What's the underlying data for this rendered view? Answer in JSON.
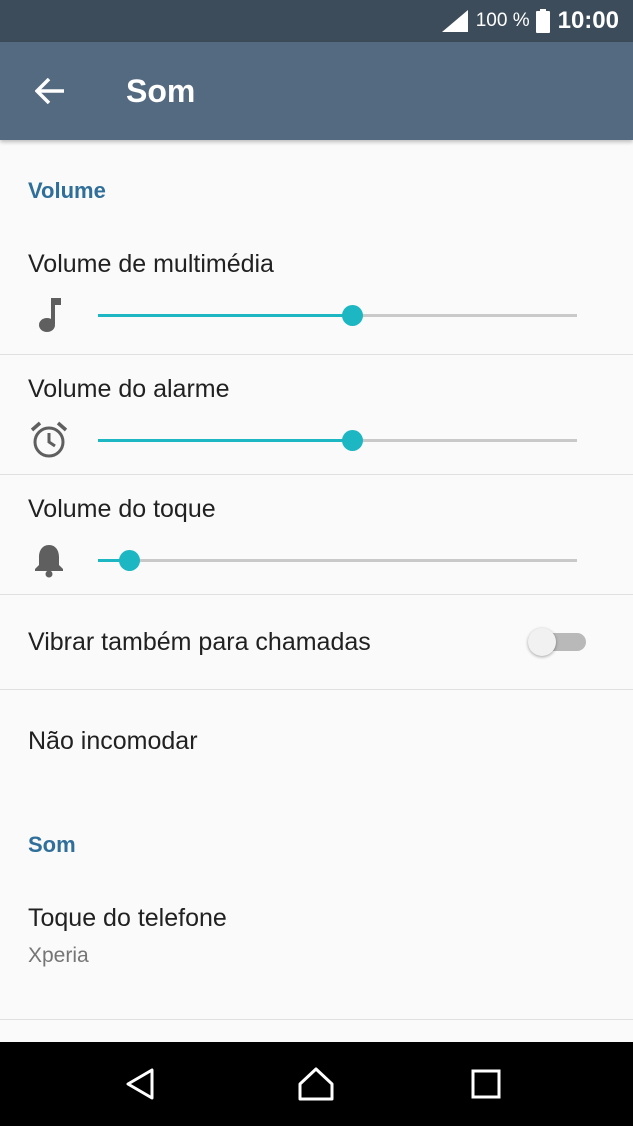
{
  "status_bar": {
    "battery_percent": "100 %",
    "time": "10:00",
    "icons": [
      "signal-icon",
      "battery-icon"
    ]
  },
  "app_bar": {
    "title": "Som",
    "back_icon": "arrow-back-icon"
  },
  "sections": {
    "volume_header": "Volume",
    "som_header": "Som"
  },
  "volume_sliders": [
    {
      "label": "Volume de multimédia",
      "icon": "music-note-icon",
      "level": 0.53
    },
    {
      "label": "Volume do alarme",
      "icon": "alarm-clock-icon",
      "level": 0.53
    },
    {
      "label": "Volume do toque",
      "icon": "bell-icon",
      "level": 0.065
    }
  ],
  "vibrate": {
    "label": "Vibrar também para chamadas",
    "enabled": false
  },
  "do_not_disturb": {
    "label": "Não incomodar"
  },
  "ringtone": {
    "label": "Toque do telefone",
    "value": "Xperia"
  },
  "navigation": {
    "icons": [
      "back-triangle-icon",
      "home-icon",
      "recents-icon"
    ]
  },
  "colors": {
    "accent": "#1cb7c3",
    "section_header": "#2f6f9a",
    "app_bar": "#546a80",
    "status_bar": "#3c4c5a"
  }
}
